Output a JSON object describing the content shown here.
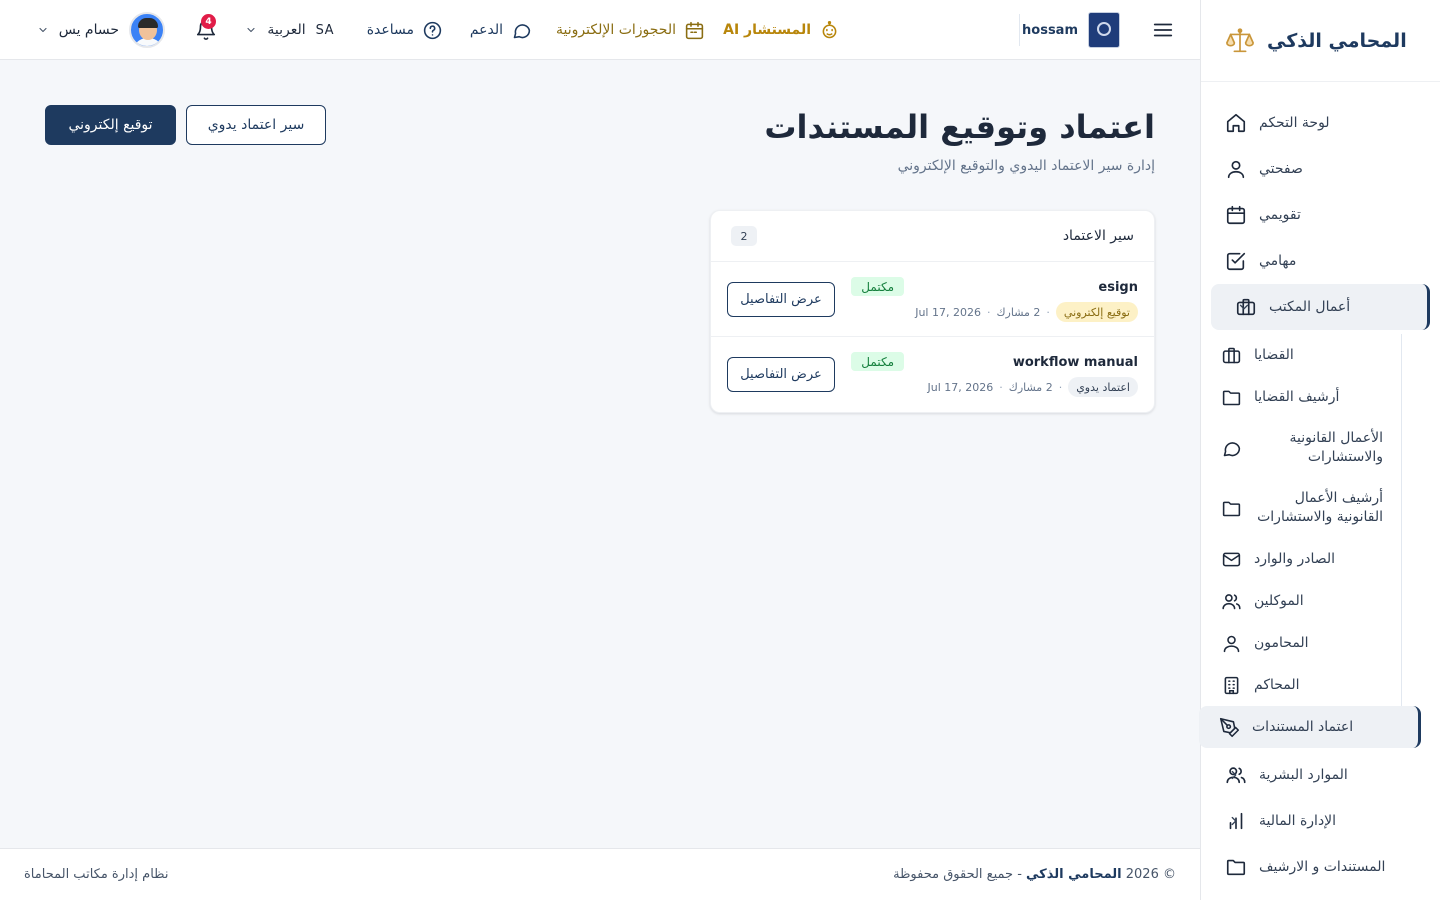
{
  "colors": {
    "primary": "#1e3a5f",
    "accent_gold": "#b8860b",
    "success_bg": "#dcfce7",
    "success_text": "#15803d",
    "badge_red": "#e11d48"
  },
  "sidebar": {
    "brand": "المحامي الذكي",
    "brand_icon": "scales-icon",
    "items": [
      {
        "label": "لوحة التحكم",
        "icon": "home-icon"
      },
      {
        "label": "صفحتي",
        "icon": "user-icon"
      },
      {
        "label": "تقويمي",
        "icon": "calendar-icon"
      },
      {
        "label": "مهامي",
        "icon": "check-square-icon"
      }
    ],
    "office_group": {
      "label": "أعمال المكتب",
      "icon": "briefcase-icon",
      "children": [
        {
          "label": "القضايا",
          "icon": "briefcase-icon"
        },
        {
          "label": "أرشيف القضايا",
          "icon": "folder-icon"
        },
        {
          "label": "الأعمال القانونية والاستشارات",
          "icon": "chat-icon"
        },
        {
          "label": "أرشيف الأعمال القانونية والاستشارات",
          "icon": "folder-icon"
        },
        {
          "label": "الصادر والوارد",
          "icon": "mail-icon"
        },
        {
          "label": "الموكلين",
          "icon": "users-icon"
        },
        {
          "label": "المحامون",
          "icon": "user-icon"
        },
        {
          "label": "المحاكم",
          "icon": "building-icon"
        },
        {
          "label": "اعتماد المستندات",
          "icon": "pen-icon",
          "active": true
        }
      ]
    },
    "after_items": [
      {
        "label": "الموارد البشرية",
        "icon": "users-icon"
      },
      {
        "label": "الإدارة المالية",
        "icon": "bar-chart-icon"
      },
      {
        "label": "المستندات و الارشيف",
        "icon": "folder-icon"
      }
    ]
  },
  "topbar": {
    "user_name": "hossam",
    "ai_label": "المستشار AI",
    "bookings_label": "الحجوزات الإلكترونية",
    "support_label": "الدعم",
    "help_label": "مساعدة",
    "language_code": "SA",
    "language_label": "العربية",
    "notifications_count": "4",
    "profile_name": "حسام يس"
  },
  "main": {
    "title": "اعتماد وتوقيع المستندات",
    "subtitle": "إدارة سير الاعتماد اليدوي والتوقيع الإلكتروني",
    "esign_button": "توقيع إلكتروني",
    "manual_button": "سير اعتماد يدوي",
    "card": {
      "title": "سير الاعتماد",
      "count": "2",
      "rows": [
        {
          "name": "esign",
          "type": "توقيع إلكتروني",
          "type_kind": "esign",
          "participants": "2 مشارك",
          "date": "Jul 17, 2026",
          "status": "مكتمل",
          "action": "عرض التفاصيل"
        },
        {
          "name": "workflow manual",
          "type": "اعتماد يدوي",
          "type_kind": "manual",
          "participants": "2 مشارك",
          "date": "Jul 17, 2026",
          "status": "مكتمل",
          "action": "عرض التفاصيل"
        }
      ]
    }
  },
  "footer": {
    "copyright_prefix": "© 2026",
    "brand": "المحامي الذكي",
    "rights": "- جميع الحقوق محفوظة",
    "system": "نظام إدارة مكاتب المحاماة"
  }
}
